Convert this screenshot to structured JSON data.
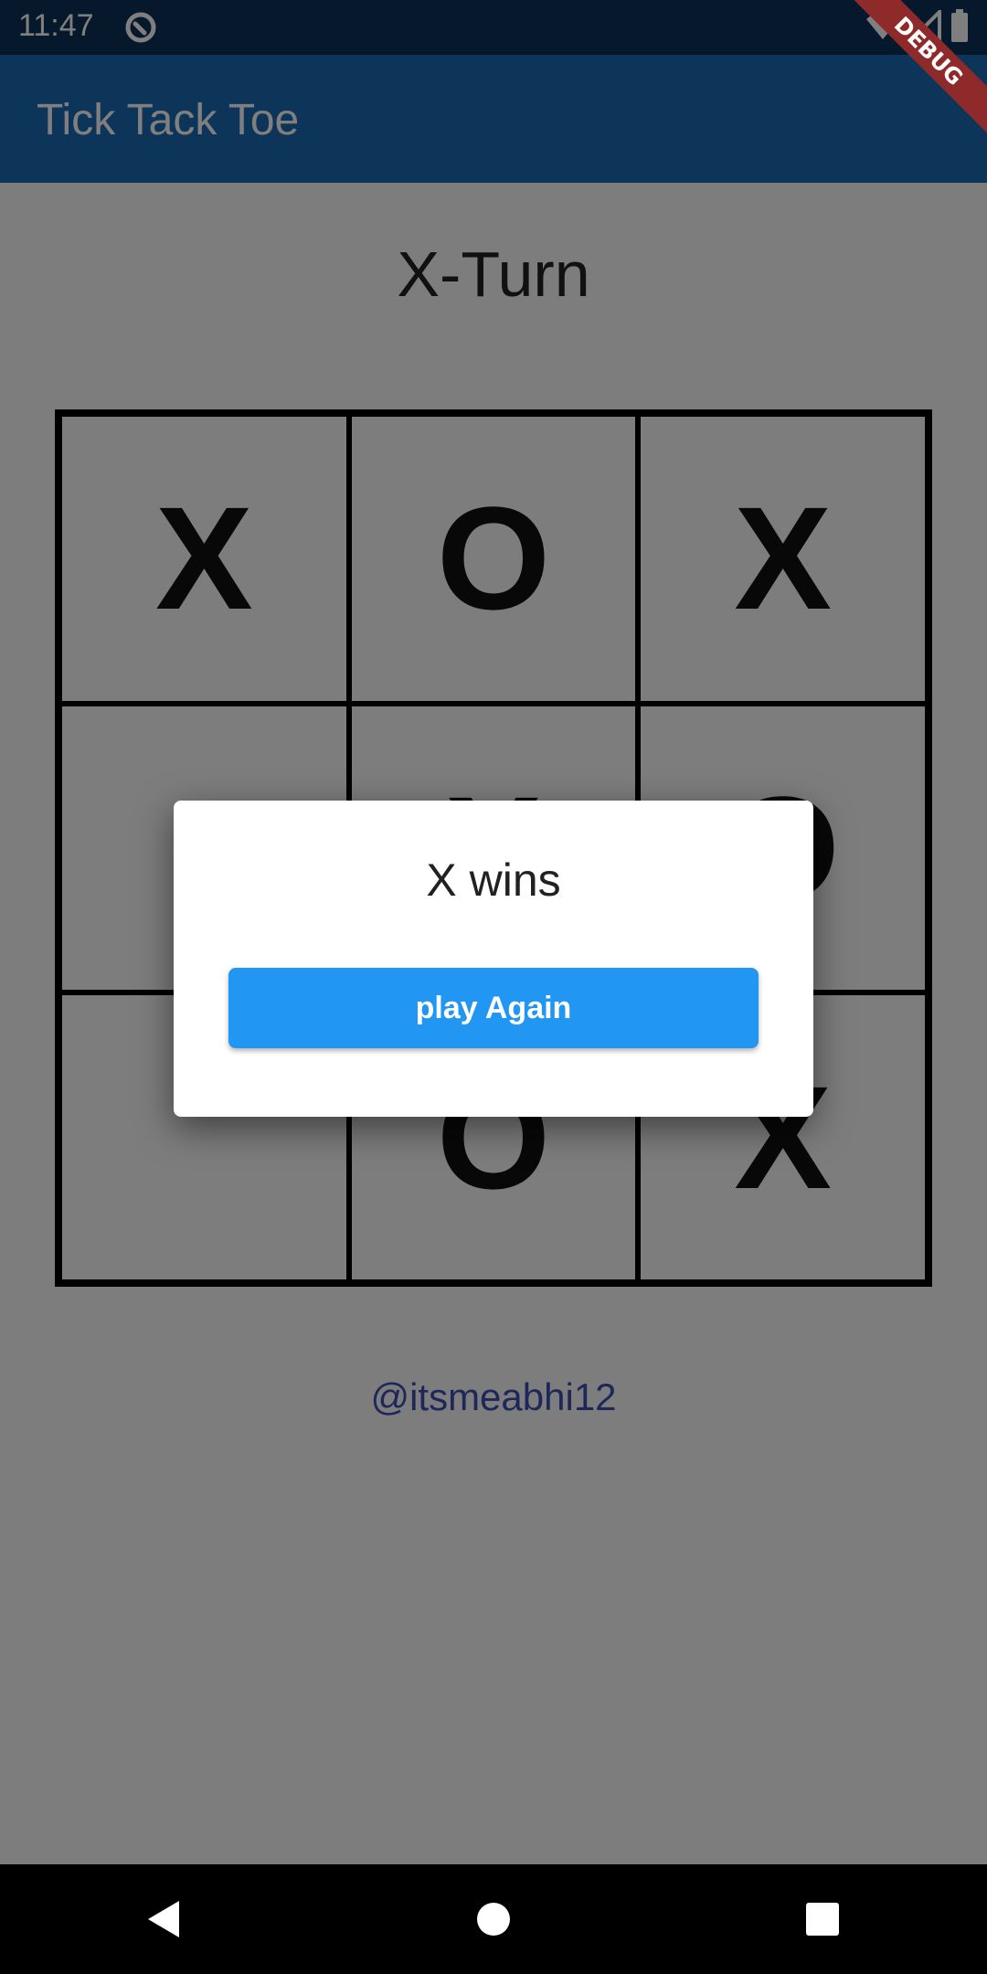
{
  "status_bar": {
    "time": "11:47",
    "icons": [
      "app-notification-icon",
      "wifi-icon",
      "signal-icon",
      "battery-icon"
    ]
  },
  "app_bar": {
    "title": "Tick Tack Toe"
  },
  "debug_banner": {
    "label": "DEBUG",
    "color": "#8e2a2a"
  },
  "game": {
    "turn_label": "X-Turn",
    "board": [
      [
        "X",
        "O",
        "X"
      ],
      [
        "",
        "X",
        "O"
      ],
      [
        "",
        "O",
        "X"
      ]
    ]
  },
  "credit": {
    "text": "@itsmeabhi12",
    "color": "#3b4fb3"
  },
  "dialog": {
    "title": "X wins",
    "button_label": "play Again",
    "button_color": "#2196f3"
  },
  "nav_bar": {
    "icons": [
      "back-icon",
      "home-icon",
      "recents-icon"
    ]
  },
  "colors": {
    "app_bar": "#1b6bb4",
    "status_bar": "#0d3158"
  }
}
